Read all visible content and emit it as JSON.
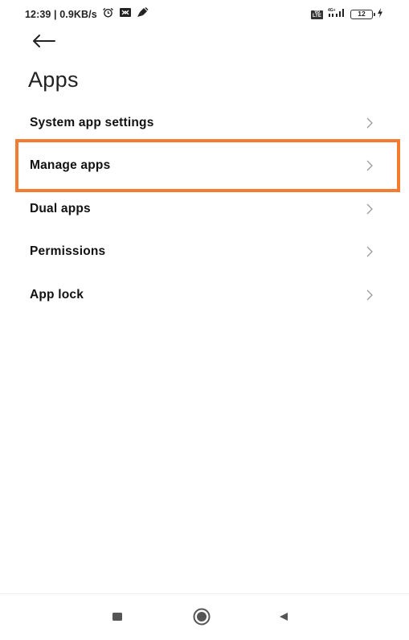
{
  "status_bar": {
    "time_speed": "12:39 | 0.9KB/s",
    "network_badge": "VoLTE",
    "network_type": "4G+",
    "battery_level": "12",
    "icons": [
      "alarm-icon",
      "screen-rotate-icon",
      "broom-icon",
      "volte-icon",
      "signal-icon",
      "battery-icon",
      "charging-icon"
    ]
  },
  "header": {
    "title": "Apps"
  },
  "menu": {
    "items": [
      {
        "label": "System app settings"
      },
      {
        "label": "Manage apps",
        "highlighted": true
      },
      {
        "label": "Dual apps"
      },
      {
        "label": "Permissions"
      },
      {
        "label": "App lock"
      }
    ]
  },
  "colors": {
    "highlight": "#f47c31",
    "chevron": "#9a9a9a",
    "text": "#111111"
  }
}
